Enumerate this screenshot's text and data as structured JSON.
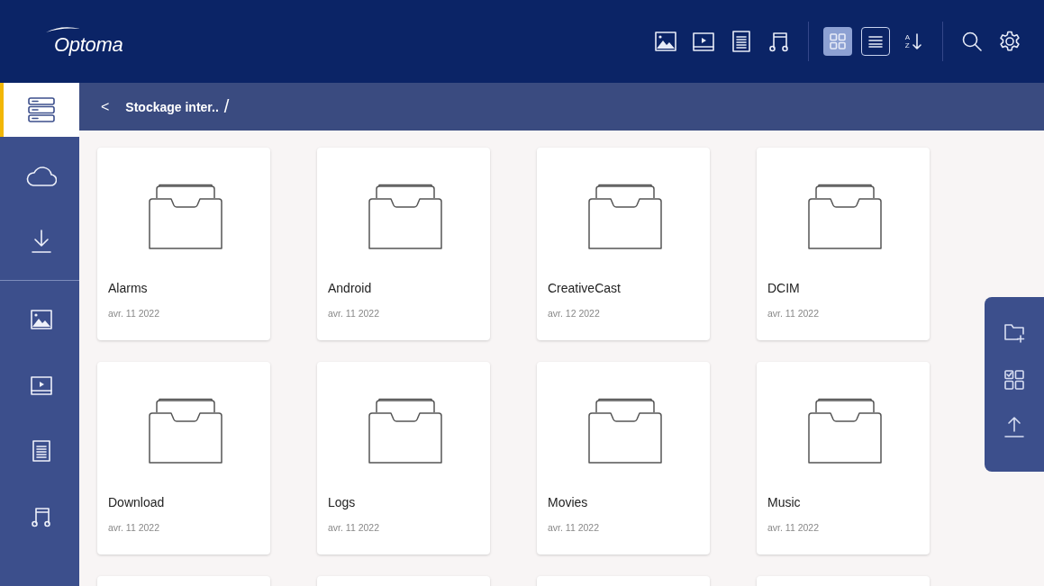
{
  "header": {
    "logo": "Optoma",
    "toolbar": [
      {
        "kind": "image",
        "selected": false
      },
      {
        "kind": "video",
        "selected": false
      },
      {
        "kind": "document",
        "selected": false
      },
      {
        "kind": "music",
        "selected": false
      },
      {
        "kind": "divider"
      },
      {
        "kind": "grid",
        "selected": true
      },
      {
        "kind": "list",
        "selected": false
      },
      {
        "kind": "sort",
        "top": "A",
        "bottom": "Z"
      },
      {
        "kind": "divider"
      },
      {
        "kind": "search"
      },
      {
        "kind": "settings"
      }
    ]
  },
  "sidebar": {
    "items": [
      {
        "kind": "storage",
        "selected": true
      },
      {
        "kind": "cloud",
        "selected": false
      },
      {
        "kind": "download",
        "selected": false
      },
      {
        "kind": "divider"
      },
      {
        "kind": "image",
        "selected": false
      },
      {
        "kind": "video",
        "selected": false
      },
      {
        "kind": "document",
        "selected": false
      },
      {
        "kind": "music",
        "selected": false
      }
    ]
  },
  "breadcrumb": {
    "back": "<",
    "path": "Stockage inter..",
    "separator": "/"
  },
  "folders": [
    {
      "kind": "folder",
      "name": "Alarms",
      "date": "avr. 11 2022"
    },
    {
      "kind": "folder",
      "name": "Android",
      "date": "avr. 11 2022"
    },
    {
      "kind": "folder",
      "name": "CreativeCast",
      "date": "avr. 12 2022"
    },
    {
      "kind": "folder",
      "name": "DCIM",
      "date": "avr. 11 2022"
    },
    {
      "kind": "folder",
      "name": "Download",
      "date": "avr. 11 2022"
    },
    {
      "kind": "folder",
      "name": "Logs",
      "date": "avr. 11 2022"
    },
    {
      "kind": "folder",
      "name": "Movies",
      "date": "avr. 11 2022"
    },
    {
      "kind": "folder",
      "name": "Music",
      "date": "avr. 11 2022"
    },
    {
      "kind": "cut"
    },
    {
      "kind": "cut"
    },
    {
      "kind": "cut"
    },
    {
      "kind": "cut"
    }
  ],
  "side_panel": [
    {
      "kind": "new-folder"
    },
    {
      "kind": "select"
    },
    {
      "kind": "upload"
    }
  ]
}
